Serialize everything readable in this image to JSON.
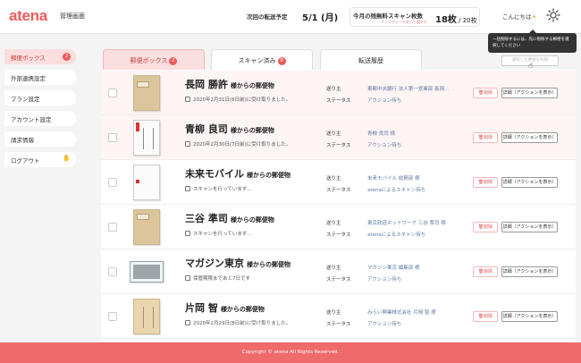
{
  "header": {
    "logo": "atena",
    "admin_label": "管理画面",
    "next_transfer_label": "次回の転送予定",
    "next_transfer_value": "5/1 (月)",
    "scans_label": "今月の残無料スキャン枚数",
    "upgrade_link": "アップグレードをして増やす",
    "scans_value": "18枚",
    "scans_total": " / 20枚",
    "greeting": "こんにちは",
    "greeting_icon": "☀"
  },
  "tooltip": "一括削除するには、先に削除する郵便を選択してください",
  "sidebar": {
    "items": [
      {
        "label": "郵便ボックス",
        "badge": "2"
      },
      {
        "label": "外部連携設定"
      },
      {
        "label": "プラン設定"
      },
      {
        "label": "アカウント設定"
      },
      {
        "label": "請求情報"
      },
      {
        "label": "ログアウト",
        "icon": "✋"
      }
    ]
  },
  "tabs": [
    {
      "label": "郵便ボックス",
      "badge": "2"
    },
    {
      "label": "スキャン済み",
      "badge": "9"
    },
    {
      "label": "転送履歴"
    }
  ],
  "bulk_delete_label": "選択した郵便を削除",
  "field_labels": {
    "sender": "送り主",
    "status": "ステータス"
  },
  "suffix": "様からの郵便物",
  "delete_label": "削除",
  "detail_label": "詳細（アクションを表示）",
  "rows": [
    {
      "name": "長岡 勝許",
      "date": "2020年2月31日(6日前)に受け取りました。",
      "sender": "東都中央銀行 法人第一営業部 長岡...",
      "status": "アクション待ち"
    },
    {
      "name": "青柳 良司",
      "date": "2020年2月30日(7日前)に受け取りました。",
      "sender": "青柳 良司 様",
      "status": "アクション待ち"
    },
    {
      "name": "未来モバイル",
      "date": "スキャンを行っています…",
      "sender": "未来モバイル 総務部 様",
      "status": "atenaによるスキャン待ち"
    },
    {
      "name": "三谷 準司",
      "date": "スキャンを行っています…",
      "sender": "東京政道ネットワーク 三谷 準司 様",
      "status": "atenaによるスキャン待ち"
    },
    {
      "name": "マガジン東京",
      "date": "保管期限まであと7日です",
      "sender": "マガジン東京 編集部 様",
      "status": "アクション待ち"
    },
    {
      "name": "片岡 智",
      "date": "2020年2月29日(8日前)に受け取りました。",
      "sender": "みらい興業株式会社 片岡 智 様",
      "status": "アクション待ち"
    }
  ],
  "footer": "Copyright © atena All Rights Reserved.",
  "colors": {
    "accent": "#ef5a5a",
    "footer": "#ef6a6a",
    "active_bg": "#fbdede"
  }
}
